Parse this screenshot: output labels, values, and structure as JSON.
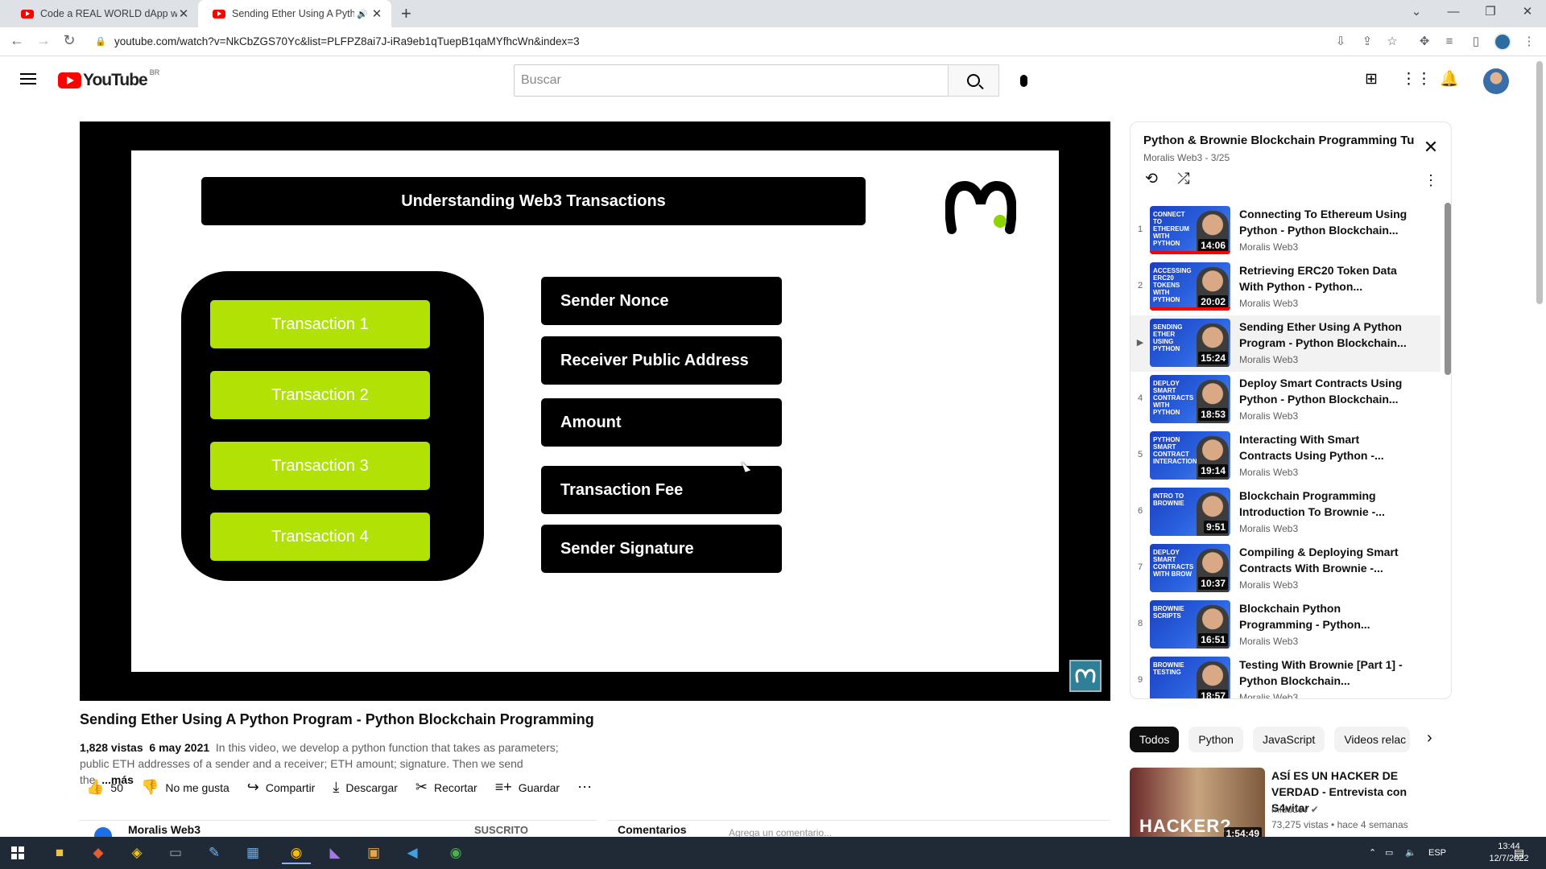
{
  "browser": {
    "tabs": [
      {
        "title": "Code a REAL WORLD dApp with",
        "active": false
      },
      {
        "title": "Sending Ether Using A Pytho",
        "active": true
      }
    ],
    "new_tab": "+",
    "url": "youtube.com/watch?v=NkCbZGS70Yc&list=PLFPZ8ai7J-iRa9eb1qTuepB1qaMYfhcWn&index=3"
  },
  "masthead": {
    "logo_text": "YouTube",
    "country_code": "BR",
    "search_placeholder": "Buscar"
  },
  "slide": {
    "title": "Understanding Web3 Transactions",
    "transactions": [
      "Transaction 1",
      "Transaction 2",
      "Transaction 3",
      "Transaction 4"
    ],
    "fields": [
      "Sender Nonce",
      "Receiver Public Address",
      "Amount",
      "Transaction Fee",
      "Sender Signature"
    ],
    "accent_color": "#b2e205"
  },
  "video": {
    "title": "Sending Ether Using A Python Program - Python Blockchain Programming",
    "views": "1,828 vistas",
    "date": "6 may 2021",
    "description_1": "In this video, we develop a python function that takes as parameters;",
    "description_2": "public ETH addresses of a sender and a receiver; ETH amount; signature. Then we send the",
    "more": "...más",
    "actions": {
      "likes": "50",
      "dislike": "No me gusta",
      "share": "Compartir",
      "download": "Descargar",
      "clip": "Recortar",
      "save": "Guardar"
    },
    "channel": "Moralis Web3",
    "subscribe": "SUSCRITO",
    "comments_label": "Comentarios",
    "comment_placeholder": "Agrega un comentario..."
  },
  "playlist": {
    "title": "Python & Brownie Blockchain Programming Tutoria...",
    "subtitle": "Moralis Web3 - 3/25",
    "items": [
      {
        "index": "1",
        "title": "Connecting To Ethereum Using Python - Python Blockchain...",
        "channel": "Moralis Web3",
        "duration": "14:06",
        "thumb_text": "Connect to Ethereum with Python",
        "watched": true
      },
      {
        "index": "2",
        "title": "Retrieving ERC20 Token Data With Python - Python...",
        "channel": "Moralis Web3",
        "duration": "20:02",
        "thumb_text": "Accessing ERC20 Tokens with Python",
        "watched": true
      },
      {
        "index": "▶",
        "title": "Sending Ether Using A Python Program - Python Blockchain...",
        "channel": "Moralis Web3",
        "duration": "15:24",
        "thumb_text": "Sending Ether Using Python",
        "current": true
      },
      {
        "index": "4",
        "title": "Deploy Smart Contracts Using Python - Python Blockchain...",
        "channel": "Moralis Web3",
        "duration": "18:53",
        "thumb_text": "Deploy Smart Contracts with Python"
      },
      {
        "index": "5",
        "title": "Interacting With Smart Contracts Using Python -...",
        "channel": "Moralis Web3",
        "duration": "19:14",
        "thumb_text": "Python Smart Contract Interaction"
      },
      {
        "index": "6",
        "title": "Blockchain Programming Introduction To Brownie -...",
        "channel": "Moralis Web3",
        "duration": "9:51",
        "thumb_text": "Intro to Brownie"
      },
      {
        "index": "7",
        "title": "Compiling & Deploying Smart Contracts With Brownie -...",
        "channel": "Moralis Web3",
        "duration": "10:37",
        "thumb_text": "Deploy Smart Contracts with Brow"
      },
      {
        "index": "8",
        "title": "Blockchain Python Programming - Python...",
        "channel": "Moralis Web3",
        "duration": "16:51",
        "thumb_text": "Brownie Scripts"
      },
      {
        "index": "9",
        "title": "Testing With Brownie [Part 1] - Python Blockchain...",
        "channel": "Moralis Web3",
        "duration": "18:57",
        "thumb_text": "Brownie Testing"
      }
    ]
  },
  "chips": [
    "Todos",
    "Python",
    "JavaScript",
    "Videos relac"
  ],
  "recommendation": {
    "title": "ASÍ ES UN HACKER DE VERDAD - Entrevista con S4vitar",
    "channel": "midudev",
    "meta": "73,275 vistas • hace 4 semanas",
    "duration": "1:54:49",
    "thumb_text": "HACKER?"
  },
  "taskbar": {
    "lang": "ESP",
    "time": "13:44",
    "date": "12/7/2022"
  },
  "icons": {
    "like": "thumbs-up-icon",
    "dislike": "thumbs-down-icon",
    "share": "share-icon",
    "download": "download-icon",
    "clip": "scissors-icon",
    "save": "playlist-add-icon"
  }
}
